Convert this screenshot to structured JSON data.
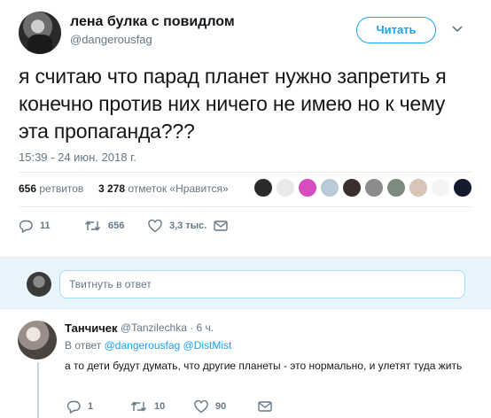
{
  "tweet": {
    "display_name": "лена булка с повидлом",
    "username": "@dangerousfag",
    "follow_label": "Читать",
    "text": "я считаю что парад планет нужно запретить я конечно против них ничего не имею но к чему эта пропаганда???",
    "timestamp": "15:39 - 24 июн. 2018 г.",
    "retweets_count": "656",
    "retweets_label": "ретвитов",
    "likes_count": "3 278",
    "likes_label": "отметок «Нравится»",
    "liker_colors": [
      "#2b2b2b",
      "#e9e9e9",
      "#d84cc2",
      "#b9cbd8",
      "#3a2f2c",
      "#8c8c8c",
      "#7d8b7e",
      "#d8c4b8",
      "#f4f4f4",
      "#151a2e"
    ],
    "actions": {
      "replies": "11",
      "retweets": "656",
      "likes": "3,3 тыс."
    }
  },
  "reply_box": {
    "placeholder": "Твитнуть в ответ"
  },
  "reply": {
    "name": "Танчичек",
    "handle": "@Tanzilechka · 6 ч.",
    "reply_to_prefix": "В ответ",
    "reply_to_user1": "@dangerousfag",
    "reply_to_user2": "@DistMist",
    "text": "а то дети будут думать, что другие планеты - это нормально, и улетят туда жить",
    "actions": {
      "replies": "1",
      "retweets": "10",
      "likes": "90"
    }
  },
  "colors": {
    "accent": "#1da1f2",
    "secondary_text": "#657786",
    "reply_box_bg": "#e8f5fd"
  }
}
